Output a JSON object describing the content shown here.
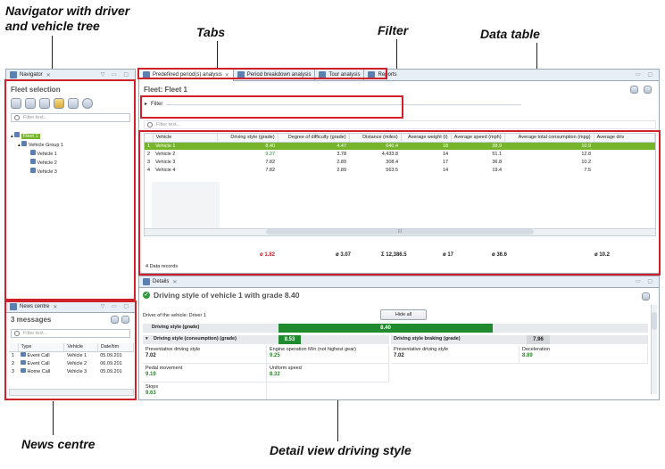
{
  "annotations": {
    "navigator": "Navigator with driver and vehicle tree",
    "navigator_l1": "Navigator with driver",
    "navigator_l2": "and vehicle tree",
    "tabs": "Tabs",
    "filter": "Filter",
    "data_table": "Data table",
    "news_centre": "News centre",
    "detail_view": "Detail view driving style"
  },
  "navigator": {
    "tab_label": "Navigator",
    "title": "Fleet selection",
    "toolbar_icons": [
      "driver-icon",
      "group-icon",
      "vehicle-icon",
      "folder-icon",
      "arrow-icon",
      "refresh-icon"
    ],
    "search_placeholder": "Filter text...",
    "tree": {
      "root": "Fleet 1",
      "group": "Vehicle Group 1",
      "vehicles": [
        "Vehicle 1",
        "Vehicle 2",
        "Vehicle 3"
      ]
    }
  },
  "news": {
    "tab_label": "News centre",
    "title": "3 messages",
    "search_placeholder": "Filter text...",
    "columns": [
      "Type",
      "Vehicle",
      "Date/tim"
    ],
    "rows": [
      {
        "idx": "1",
        "type": "Event Call",
        "vehicle": "Vehicle 1",
        "date": "05.09.201"
      },
      {
        "idx": "2",
        "type": "Event Call",
        "vehicle": "Vehicle 2",
        "date": "06.09.201"
      },
      {
        "idx": "3",
        "type": "Home Call",
        "vehicle": "Vehicle 3",
        "date": "05.09.201"
      }
    ]
  },
  "tabs": [
    "Predefined period(s) analysis",
    "Period breakdown analysis",
    "Tour analysis",
    "Reports"
  ],
  "main": {
    "fleet_title": "Fleet: Fleet 1",
    "filter_label": "Filter",
    "search_placeholder": "Filter text...",
    "columns": [
      "Vehicle",
      "Driving style (grade)",
      "Degree of difficulty (grade)",
      "Distance (miles)",
      "Average weight (t)",
      "Average speed (mph)",
      "Average total consumption (mpg)",
      "Average driv"
    ],
    "rows": [
      {
        "idx": "1",
        "vehicle": "Vehicle 1",
        "style": "8.40",
        "difficulty": "4.47",
        "distance": "640.4",
        "weight": "18",
        "speed": "38.9",
        "consumption": "10.9"
      },
      {
        "idx": "2",
        "vehicle": "Vehicle 2",
        "style": "9.27",
        "difficulty": "3.78",
        "distance": "4,433.8",
        "weight": "14",
        "speed": "51.1",
        "consumption": "12.8"
      },
      {
        "idx": "3",
        "vehicle": "Vehicle 3",
        "style": "7.82",
        "difficulty": "2.89",
        "distance": "308.4",
        "weight": "17",
        "speed": "36.8",
        "consumption": "10.2"
      },
      {
        "idx": "4",
        "vehicle": "Vehicle 4",
        "style": "7.82",
        "difficulty": "2.89",
        "distance": "563.5",
        "weight": "14",
        "speed": "19.4",
        "consumption": "7.5"
      }
    ],
    "summary": {
      "style": "ø 1.82",
      "difficulty": "ø 3.07",
      "distance": "Σ 12,386.5",
      "weight": "ø 17",
      "speed": "ø 36.6",
      "consumption": "ø 10.2"
    },
    "records": "4 Data records",
    "scroll_thumb": "III"
  },
  "details": {
    "tab_label": "Details",
    "title": "Driving style of vehicle 1 with grade 8.40",
    "driver_label": "Driver of the vehicle: Driver 1",
    "hide_all": "Hide all",
    "driving_style_label": "Driving style (grade)",
    "driving_style_value": "8.40",
    "driving_style_fraction": 0.84,
    "consumption_label": "Driving style (consumption) (grade)",
    "consumption_value": "8.53",
    "braking_label": "Driving style braking (grade)",
    "braking_value": "7.96",
    "cells_left": [
      {
        "label": "Preventative driving style",
        "value": "7.02"
      },
      {
        "label": "Engine operation M/n (not highest gear)",
        "value": "9.25"
      },
      {
        "label": "Pedal movement",
        "value": "9.19"
      },
      {
        "label": "Uniform speed",
        "value": "8.32"
      },
      {
        "label": "Stops",
        "value": "9.63"
      }
    ],
    "cells_right": [
      {
        "label": "Preventative driving style",
        "value": "7.02"
      },
      {
        "label": "Deceleration",
        "value": "8.89"
      }
    ]
  },
  "colors": {
    "highlight": "#d0202a",
    "accent": "#76b52b",
    "grade_green": "#1f8a2e"
  }
}
